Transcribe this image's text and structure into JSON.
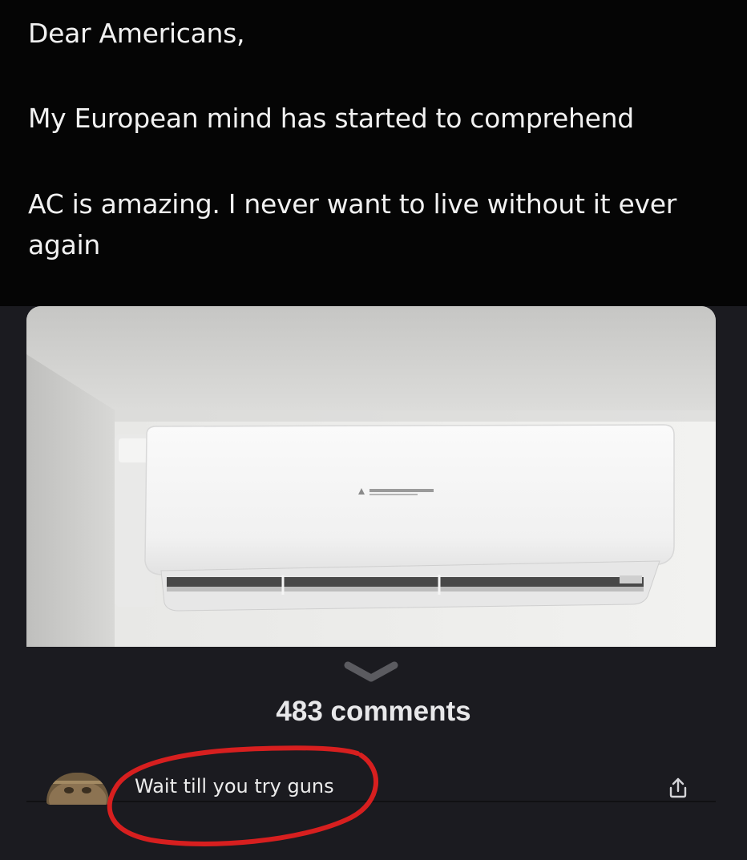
{
  "post": {
    "greeting": "Dear Americans,",
    "line_mind": "My European mind has started to comprehend",
    "line_ac": "AC is amazing. I never want to live without it ever",
    "line_again": "again"
  },
  "photo": {
    "subject": "wall-mounted air conditioner",
    "brand_lettering": "MITSUBISHI"
  },
  "comments": {
    "count_label": "483 comments"
  },
  "comment": {
    "text": "Wait till you try guns"
  },
  "icons": {
    "collapse": "chevron-down-icon",
    "share": "share-icon",
    "highlight": "red-circle-annotation"
  },
  "colors": {
    "post_background": "#050505",
    "comments_background": "#1b1b20",
    "highlight": "#d71f1f"
  }
}
